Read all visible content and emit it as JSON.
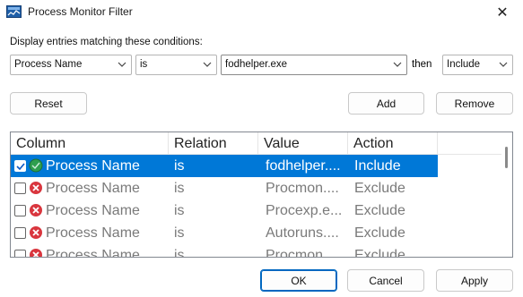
{
  "window": {
    "title": "Process Monitor Filter",
    "close_glyph": "✕"
  },
  "conditions": {
    "label": "Display entries matching these conditions:",
    "column_select": "Process Name",
    "relation_select": "is",
    "value_input": "fodhelper.exe",
    "then_label": "then",
    "action_select": "Include"
  },
  "buttons": {
    "reset": "Reset",
    "add": "Add",
    "remove": "Remove",
    "ok": "OK",
    "cancel": "Cancel",
    "apply": "Apply"
  },
  "list": {
    "headers": [
      "Column",
      "Relation",
      "Value",
      "Action"
    ],
    "rows": [
      {
        "checked": true,
        "icon": "include-icon",
        "column": "Process Name",
        "relation": "is",
        "value": "fodhelper....",
        "action": "Include",
        "selected": true
      },
      {
        "checked": false,
        "icon": "exclude-icon",
        "column": "Process Name",
        "relation": "is",
        "value": "Procmon....",
        "action": "Exclude",
        "selected": false
      },
      {
        "checked": false,
        "icon": "exclude-icon",
        "column": "Process Name",
        "relation": "is",
        "value": "Procexp.e...",
        "action": "Exclude",
        "selected": false
      },
      {
        "checked": false,
        "icon": "exclude-icon",
        "column": "Process Name",
        "relation": "is",
        "value": "Autoruns....",
        "action": "Exclude",
        "selected": false
      },
      {
        "checked": false,
        "icon": "exclude-icon",
        "column": "Process Name",
        "relation": "is",
        "value": "Procmon....",
        "action": "Exclude",
        "selected": false
      }
    ]
  },
  "colors": {
    "selection": "#0078d7",
    "include_green": "#2e9e4f",
    "exclude_red": "#d9363e",
    "primary_border": "#0067c0"
  }
}
